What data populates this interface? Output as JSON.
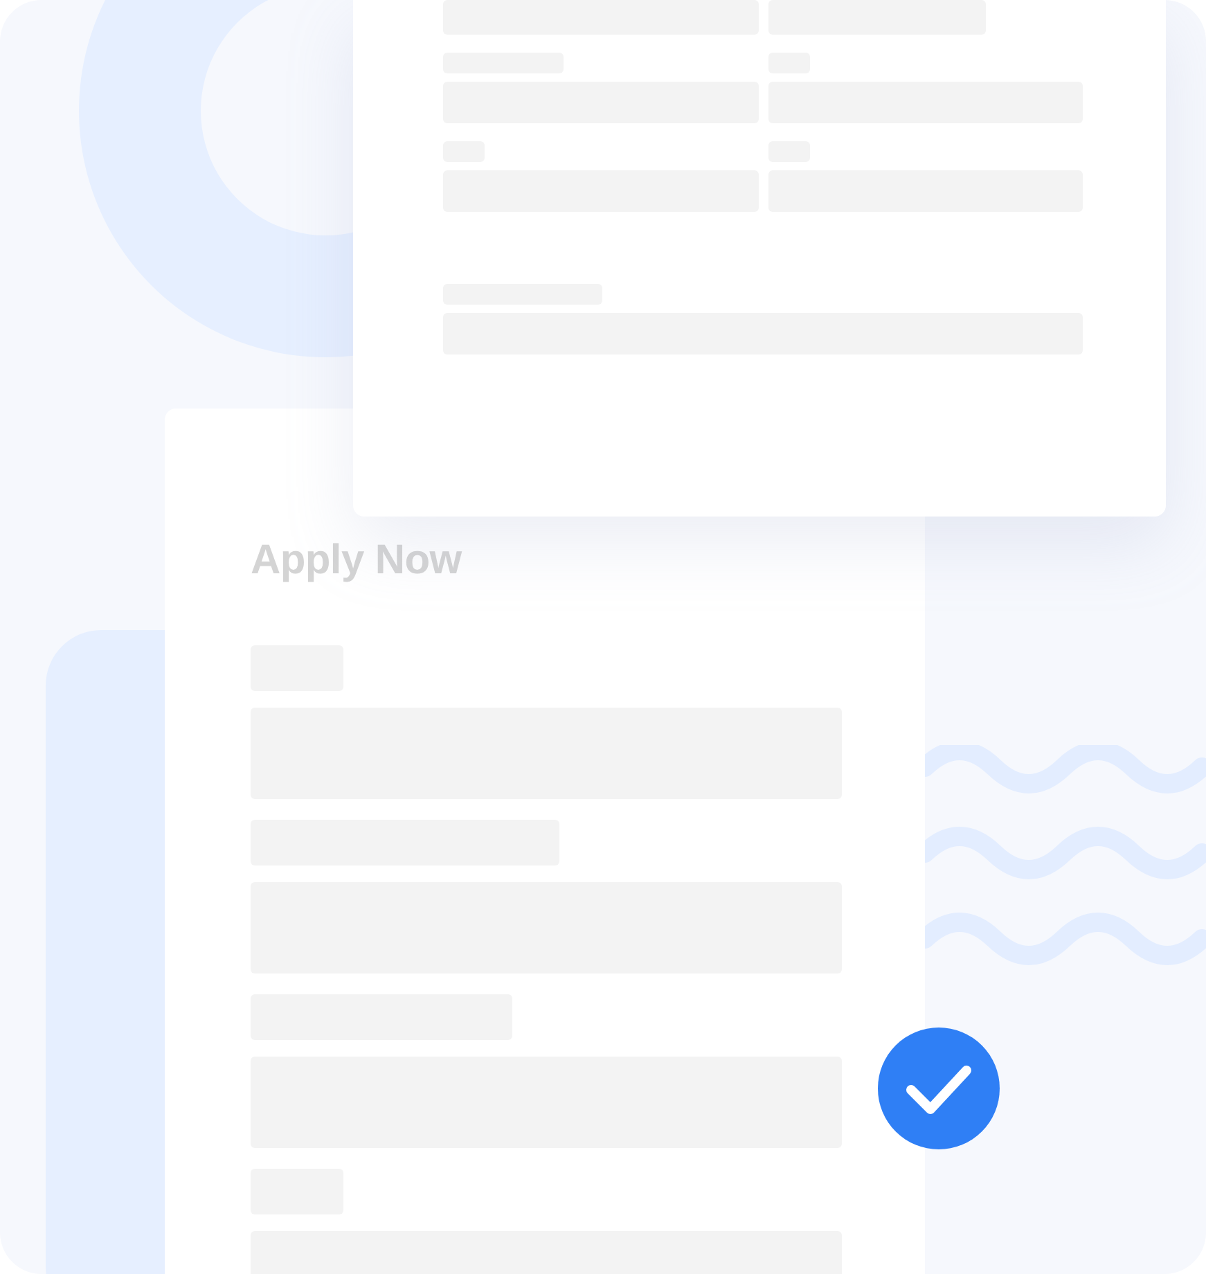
{
  "form": {
    "title": "Apply Now"
  }
}
